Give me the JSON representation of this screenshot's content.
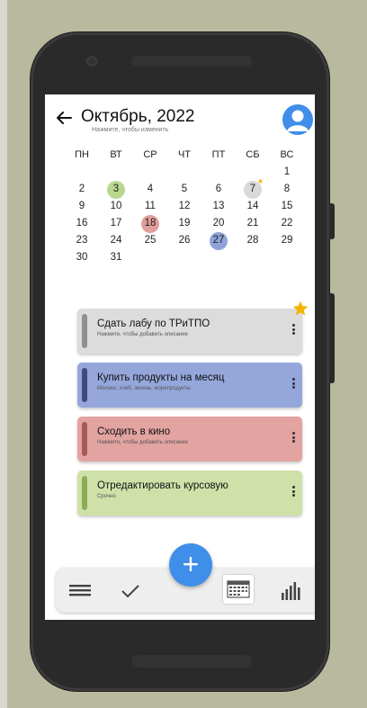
{
  "header": {
    "title": "Октябрь, 2022",
    "subtitle": "Нажмите, чтобы изменить"
  },
  "calendar": {
    "weekdays": [
      "ПН",
      "ВТ",
      "СР",
      "ЧТ",
      "ПТ",
      "СБ",
      "ВС"
    ],
    "weeks": [
      [
        "",
        "",
        "",
        "",
        "",
        "",
        "1"
      ],
      [
        "2",
        "3",
        "4",
        "5",
        "6",
        "7",
        "8"
      ],
      [
        "9",
        "10",
        "11",
        "12",
        "13",
        "14",
        "15"
      ],
      [
        "16",
        "17",
        "18",
        "19",
        "20",
        "21",
        "22"
      ],
      [
        "23",
        "24",
        "25",
        "26",
        "27",
        "28",
        "29"
      ],
      [
        "30",
        "31",
        "",
        "",
        "",
        "",
        ""
      ]
    ],
    "highlights": {
      "3": "#b9d88e",
      "7": "#d9d9d9",
      "18": "#e09e9c",
      "27": "#8fa3d8"
    },
    "starred_day": "7",
    "star_color": "#f2b400"
  },
  "tasks": [
    {
      "title": "Сдать лабу по ТРиТПО",
      "description": "Нажмите, чтобы добавить описание",
      "bg": "#dcdcdc",
      "bar": "#8f8f8f",
      "starred": true
    },
    {
      "title": "Купить продукты на месяц",
      "description": "Молоко, хлеб, зелень, морепродукты",
      "bg": "#95a6da",
      "bar": "#3f4a80",
      "starred": false
    },
    {
      "title": "Сходить в кино",
      "description": "Нажмите, чтобы добавить описание",
      "bg": "#e2a3a1",
      "bar": "#a65b5a",
      "starred": false
    },
    {
      "title": "Отредактировать курсовую",
      "description": "Срочно",
      "bg": "#cfe1a8",
      "bar": "#8bad58",
      "starred": false
    }
  ],
  "nav": {
    "items": [
      "menu-icon",
      "check-icon",
      "calendar-icon",
      "bar-chart-icon"
    ],
    "active": "calendar-icon"
  },
  "fab": {
    "label": "+",
    "color": "#3f8ee9"
  },
  "colors": {
    "accent": "#3f8ee9",
    "background": "#b9b99f",
    "phone": "#2a2a2a"
  }
}
